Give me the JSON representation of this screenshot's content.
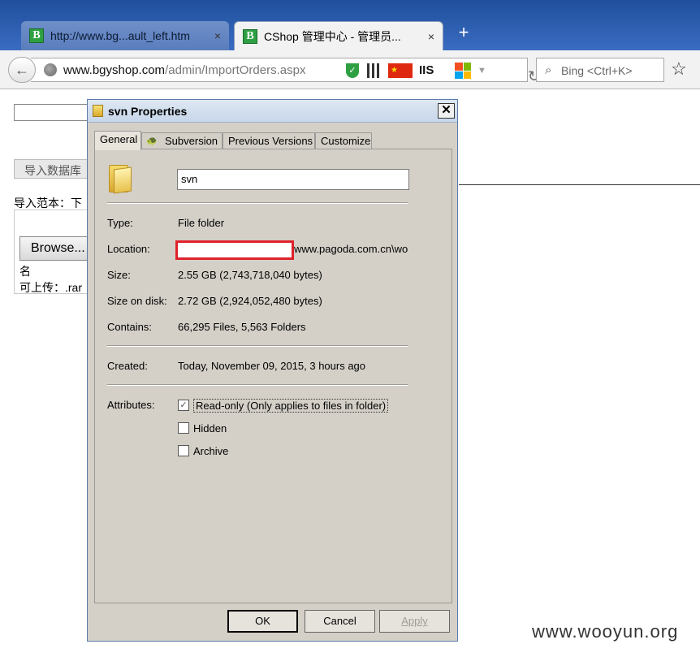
{
  "browser": {
    "tabs": [
      {
        "favicon": "B",
        "title": "http://www.bg...ault_left.htm",
        "close": "×"
      },
      {
        "favicon": "B",
        "title": "CShop 管理中心 - 管理员...",
        "close": "×"
      }
    ],
    "new_tab": "+",
    "url_host": "www.bgyshop.com",
    "url_path": "/admin/ImportOrders.aspx",
    "addon_iis": "IIS",
    "search_placeholder": "Bing <Ctrl+K>",
    "icons": [
      "back-arrow-icon",
      "globe-icon",
      "shield-icon",
      "qr-code-icon",
      "china-flag-icon",
      "iis-icon",
      "windows-logo-icon",
      "reload-icon",
      "search-icon",
      "bookmark-star-icon"
    ]
  },
  "page": {
    "import_button": "导入数据库",
    "sample_label": "导入范本：下",
    "browse_button": "Browse...",
    "name_label": "名",
    "allow_label": "可上传：.rar"
  },
  "dialog": {
    "title": "svn Properties",
    "close": "✕",
    "tabs": [
      "General",
      "Subversion",
      "Previous Versions",
      "Customize"
    ],
    "name_value": "svn",
    "properties": {
      "type_label": "Type:",
      "type_value": "File folder",
      "location_label": "Location:",
      "location_value": "www.pagoda.com.cn\\wo",
      "size_label": "Size:",
      "size_value": "2.55 GB (2,743,718,040 bytes)",
      "size_on_disk_label": "Size on disk:",
      "size_on_disk_value": "2.72 GB (2,924,052,480 bytes)",
      "contains_label": "Contains:",
      "contains_value": "66,295 Files, 5,563 Folders",
      "created_label": "Created:",
      "created_value": "Today, November 09, 2015, 3 hours ago",
      "attributes_label": "Attributes:"
    },
    "attributes": {
      "readonly": "Read-only (Only applies to files in folder)",
      "hidden": "Hidden",
      "archive": "Archive"
    },
    "buttons": {
      "ok": "OK",
      "cancel": "Cancel",
      "apply": "Apply"
    }
  },
  "watermark": "www.wooyun.org",
  "colors": {
    "redaction_border": "#e0212b",
    "dialog_bg": "#d4d0c8",
    "favicon_green": "#2ea043"
  }
}
